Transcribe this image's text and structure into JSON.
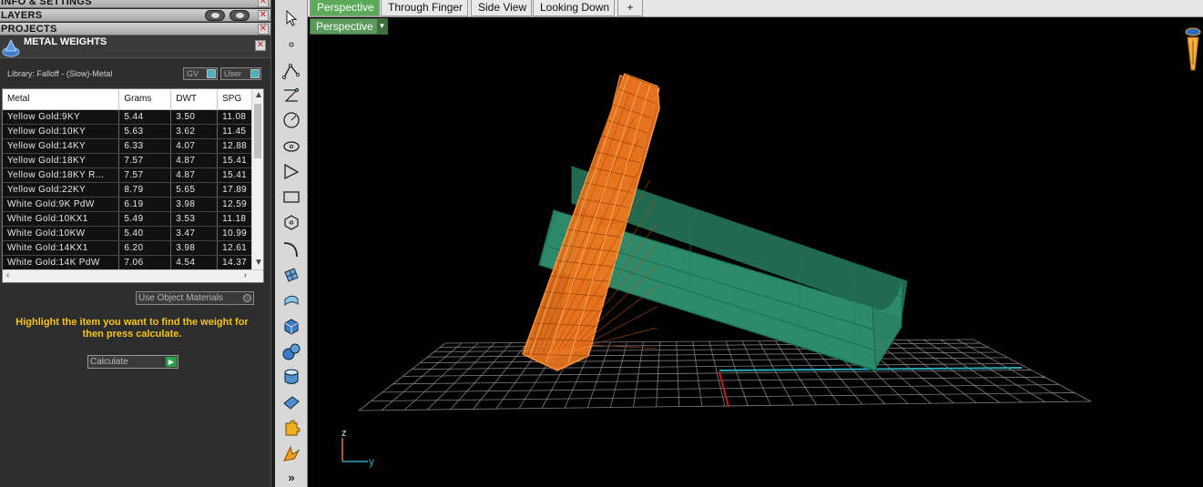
{
  "left_panel": {
    "sections": {
      "info_settings": "INFO & SETTINGS",
      "layers": "LAYERS",
      "projects": "PROJECTS"
    },
    "metal_weights": {
      "title": "METAL WEIGHTS",
      "library_label": "Library: Falloff - (Slow)-Metal",
      "gv_label": "GV",
      "user_label": "User",
      "columns": [
        "Metal",
        "Grams",
        "DWT",
        "SPG"
      ],
      "rows": [
        [
          "Yellow Gold:9KY",
          "5.44",
          "3.50",
          "11.08"
        ],
        [
          "Yellow Gold:10KY",
          "5.63",
          "3.62",
          "11.45"
        ],
        [
          "Yellow Gold:14KY",
          "6.33",
          "4.07",
          "12.88"
        ],
        [
          "Yellow Gold:18KY",
          "7.57",
          "4.87",
          "15.41"
        ],
        [
          "Yellow Gold:18KY R...",
          "7.57",
          "4.87",
          "15.41"
        ],
        [
          "Yellow Gold:22KY",
          "8.79",
          "5.65",
          "17.89"
        ],
        [
          "White Gold:9K PdW",
          "6.19",
          "3.98",
          "12.59"
        ],
        [
          "White Gold:10KX1",
          "5.49",
          "3.53",
          "11.18"
        ],
        [
          "White Gold:10KW",
          "5.40",
          "3.47",
          "10.99"
        ],
        [
          "White Gold:14KX1",
          "6.20",
          "3.98",
          "12.61"
        ],
        [
          "White Gold:14K PdW",
          "7.06",
          "4.54",
          "14.37"
        ]
      ],
      "use_object_materials": "Use Object Materials",
      "hint": "Highlight the item you want to find the weight for then press calculate.",
      "calculate_label": "Calculate"
    }
  },
  "toolbar": {
    "tools": [
      "select-arrow-icon",
      "point-icon",
      "polyline-icon",
      "curve-points-icon",
      "circle-icon",
      "ellipse-icon",
      "triangle-icon",
      "rectangle-icon",
      "polygon-icon",
      "arc-icon",
      "surface-grid-icon",
      "revolve-icon",
      "box-icon",
      "spheres-icon",
      "cylinder-icon",
      "plane-icon",
      "puzzle-icon",
      "flare-icon"
    ],
    "more": "»"
  },
  "viewport": {
    "tabs": [
      {
        "label": "Perspective",
        "active": true
      },
      {
        "label": "Through Finger",
        "active": false
      },
      {
        "label": "Side View",
        "active": false
      },
      {
        "label": "Looking Down",
        "active": false
      }
    ],
    "add_tab": "+",
    "view_label": "Perspective",
    "axis_z": "z",
    "axis_y": "y",
    "colors": {
      "ring_orange": "#f07820",
      "ring_green": "#2e8c6c",
      "grid": "#8c8c8c",
      "x_axis_line": "#2aa8b8",
      "y_axis_line": "#c0201a"
    }
  }
}
